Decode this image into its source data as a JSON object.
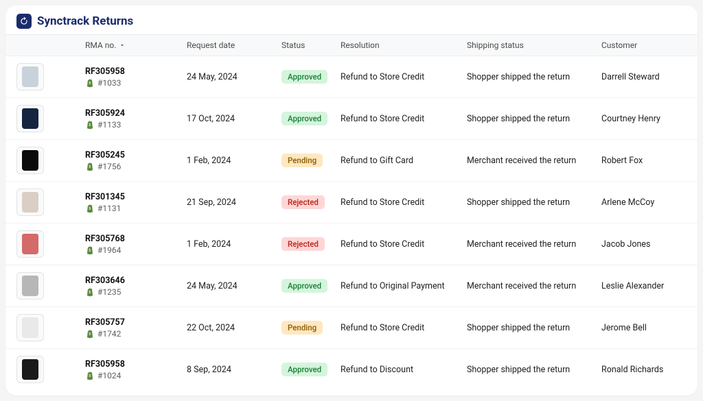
{
  "app": {
    "title": "Synctrack Returns"
  },
  "columns": {
    "rma": "RMA no.",
    "request_date": "Request date",
    "status": "Status",
    "resolution": "Resolution",
    "shipping_status": "Shipping status",
    "customer": "Customer"
  },
  "status_colors": {
    "Approved": {
      "bg": "#d4f5dc",
      "fg": "#1a7f37"
    },
    "Pending": {
      "bg": "#ffe7bf",
      "fg": "#8a5a00"
    },
    "Rejected": {
      "bg": "#ffd6d6",
      "fg": "#b42318"
    }
  },
  "icons": {
    "app_logo": "synctrack-logo",
    "shopify": "shopify-bag-icon",
    "sort": "chevron-down-icon"
  },
  "rows": [
    {
      "thumb_color": "#c9d2dc",
      "rma": "RF305958",
      "order": "#1033",
      "date": "24 May, 2024",
      "status": "Approved",
      "resolution": "Refund to Store Credit",
      "shipping": "Shopper shipped the return",
      "customer": "Darrell Steward"
    },
    {
      "thumb_color": "#16243f",
      "rma": "RF305924",
      "order": "#1133",
      "date": "17 Oct, 2024",
      "status": "Approved",
      "resolution": "Refund to Store Credit",
      "shipping": "Shopper shipped the return",
      "customer": "Courtney Henry"
    },
    {
      "thumb_color": "#0b0b0b",
      "rma": "RF305245",
      "order": "#1756",
      "date": "1 Feb, 2024",
      "status": "Pending",
      "resolution": "Refund to Gift Card",
      "shipping": "Merchant received the return",
      "customer": "Robert Fox"
    },
    {
      "thumb_color": "#d9cfc4",
      "rma": "RF301345",
      "order": "#1131",
      "date": "21 Sep, 2024",
      "status": "Rejected",
      "resolution": "Refund to Store Credit",
      "shipping": "Shopper shipped the return",
      "customer": "Arlene McCoy"
    },
    {
      "thumb_color": "#d46a6a",
      "rma": "RF305768",
      "order": "#1964",
      "date": "1 Feb, 2024",
      "status": "Rejected",
      "resolution": "Refund to Store Credit",
      "shipping": "Merchant received the return",
      "customer": "Jacob Jones"
    },
    {
      "thumb_color": "#b7b7b7",
      "rma": "RF303646",
      "order": "#1235",
      "date": "24 May, 2024",
      "status": "Approved",
      "resolution": "Refund to Original Payment",
      "shipping": "Merchant received the return",
      "customer": "Leslie Alexander"
    },
    {
      "thumb_color": "#e9e9e9",
      "rma": "RF305757",
      "order": "#1742",
      "date": "22 Oct, 2024",
      "status": "Pending",
      "resolution": "Refund to Store Credit",
      "shipping": "Shopper shipped the return",
      "customer": "Jerome Bell"
    },
    {
      "thumb_color": "#1b1b1b",
      "rma": "RF305958",
      "order": "#1024",
      "date": "8 Sep, 2024",
      "status": "Approved",
      "resolution": "Refund to Discount",
      "shipping": "Shopper shipped the return",
      "customer": "Ronald Richards"
    }
  ]
}
